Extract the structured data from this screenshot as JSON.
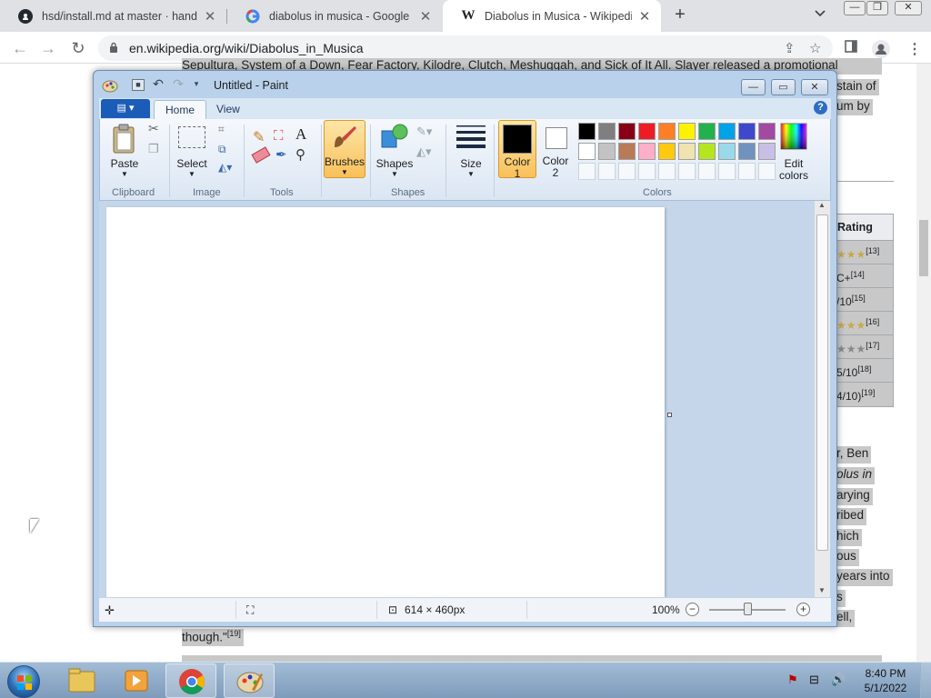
{
  "browser": {
    "tabs": [
      {
        "title": "hsd/install.md at master · handsh",
        "favicon": "github-icon",
        "active": false
      },
      {
        "title": "diabolus in musica - Google Sear",
        "favicon": "google-icon",
        "active": false
      },
      {
        "title": "Diabolus in Musica - Wikipedia",
        "favicon": "wikipedia-icon",
        "active": true
      }
    ],
    "new_tab": "+",
    "tab_menu": "⌄",
    "window_buttons": {
      "minimize": "—",
      "restore": "❐",
      "close": "✕"
    },
    "url": "en.wikipedia.org/wiki/Diabolus_in_Musica"
  },
  "wiki": {
    "top_text": "Sepultura, System of a Down, Fear Factory, Kilodre, Clutch, Meshuggah, and Sick of It All. Slayer released a promotional",
    "right_fragments": [
      {
        "text": "stain of",
        "highlight": true
      },
      {
        "text": "um by",
        "highlight": true
      },
      {
        "text": "r, Ben",
        "highlight": true
      },
      {
        "text": "olus in",
        "highlight": true
      },
      {
        "text": "arying",
        "highlight": true
      },
      {
        "text": "ribed",
        "highlight": true
      },
      {
        "text": "hich",
        "highlight": true
      },
      {
        "text": "ous",
        "highlight": true
      },
      {
        "text": "years into",
        "highlight": true
      },
      {
        "text": "s",
        "highlight": true
      },
      {
        "text": "ell,",
        "highlight": true
      }
    ],
    "bottom_quote": "though.\"",
    "bottom_quote_ref": "[19]",
    "rating_header": "Rating",
    "ratings": [
      {
        "text": "★★★",
        "ref": "[13]",
        "stars": true
      },
      {
        "text": "C+",
        "ref": "[14]",
        "stars": false
      },
      {
        "text": "/10",
        "ref": "[15]",
        "stars": false
      },
      {
        "text": "★★★",
        "ref": "[16]",
        "stars": true
      },
      {
        "text": "★★★",
        "ref": "[17]",
        "stars": true
      },
      {
        "text": "5/10",
        "ref": "[18]",
        "stars": false
      },
      {
        "text": "4/10)",
        "ref": "[19]",
        "stars": false
      }
    ]
  },
  "paint": {
    "title": "Untitled - Paint",
    "tabs": [
      {
        "label": "Home",
        "active": true
      },
      {
        "label": "View",
        "active": false
      }
    ],
    "groups": {
      "clipboard": "Clipboard",
      "image": "Image",
      "tools": "Tools",
      "shapes": "Shapes",
      "colors": "Colors"
    },
    "buttons": {
      "paste": "Paste",
      "select": "Select",
      "brushes": "Brushes",
      "shapes": "Shapes",
      "size": "Size",
      "color1_line1": "Color",
      "color1_line2": "1",
      "color2_line1": "Color",
      "color2_line2": "2",
      "edit_colors_line1": "Edit",
      "edit_colors_line2": "colors"
    },
    "color1": "#000000",
    "color2": "#ffffff",
    "palette_row1": [
      "#000000",
      "#7f7f7f",
      "#880015",
      "#ed1c24",
      "#ff7f27",
      "#fff200",
      "#22b14c",
      "#00a2e8",
      "#3f48cc",
      "#a349a4"
    ],
    "palette_row2": [
      "#ffffff",
      "#c3c3c3",
      "#b97a57",
      "#ffaec9",
      "#ffc90e",
      "#efe4b0",
      "#b5e61d",
      "#99d9ea",
      "#7092be",
      "#c8bfe7"
    ],
    "status": {
      "canvas_size": "614 × 460px",
      "zoom": "100%"
    }
  },
  "taskbar": {
    "clock_time": "8:40 PM",
    "clock_date": "5/1/2022"
  }
}
